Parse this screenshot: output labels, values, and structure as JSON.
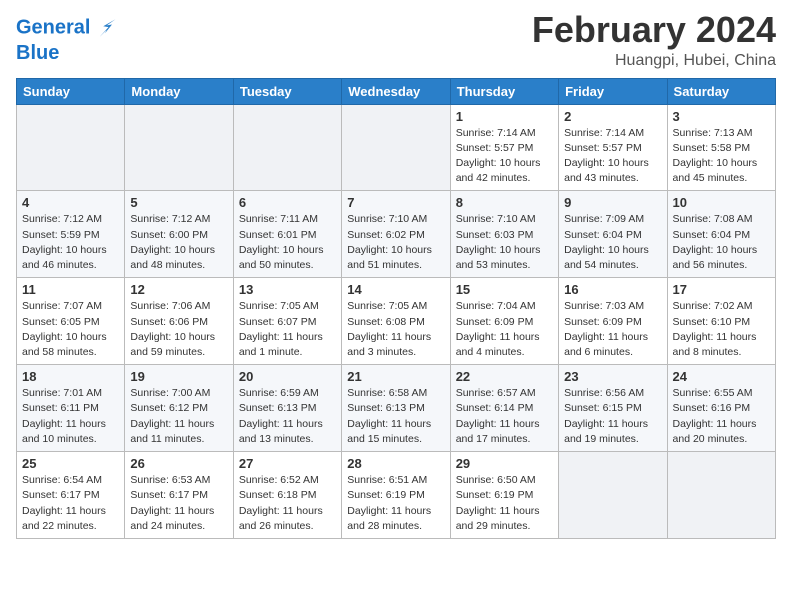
{
  "header": {
    "logo_line1": "General",
    "logo_line2": "Blue",
    "month": "February 2024",
    "location": "Huangpi, Hubei, China"
  },
  "columns": [
    "Sunday",
    "Monday",
    "Tuesday",
    "Wednesday",
    "Thursday",
    "Friday",
    "Saturday"
  ],
  "weeks": [
    [
      {
        "day": "",
        "info": ""
      },
      {
        "day": "",
        "info": ""
      },
      {
        "day": "",
        "info": ""
      },
      {
        "day": "",
        "info": ""
      },
      {
        "day": "1",
        "info": "Sunrise: 7:14 AM\nSunset: 5:57 PM\nDaylight: 10 hours\nand 42 minutes."
      },
      {
        "day": "2",
        "info": "Sunrise: 7:14 AM\nSunset: 5:57 PM\nDaylight: 10 hours\nand 43 minutes."
      },
      {
        "day": "3",
        "info": "Sunrise: 7:13 AM\nSunset: 5:58 PM\nDaylight: 10 hours\nand 45 minutes."
      }
    ],
    [
      {
        "day": "4",
        "info": "Sunrise: 7:12 AM\nSunset: 5:59 PM\nDaylight: 10 hours\nand 46 minutes."
      },
      {
        "day": "5",
        "info": "Sunrise: 7:12 AM\nSunset: 6:00 PM\nDaylight: 10 hours\nand 48 minutes."
      },
      {
        "day": "6",
        "info": "Sunrise: 7:11 AM\nSunset: 6:01 PM\nDaylight: 10 hours\nand 50 minutes."
      },
      {
        "day": "7",
        "info": "Sunrise: 7:10 AM\nSunset: 6:02 PM\nDaylight: 10 hours\nand 51 minutes."
      },
      {
        "day": "8",
        "info": "Sunrise: 7:10 AM\nSunset: 6:03 PM\nDaylight: 10 hours\nand 53 minutes."
      },
      {
        "day": "9",
        "info": "Sunrise: 7:09 AM\nSunset: 6:04 PM\nDaylight: 10 hours\nand 54 minutes."
      },
      {
        "day": "10",
        "info": "Sunrise: 7:08 AM\nSunset: 6:04 PM\nDaylight: 10 hours\nand 56 minutes."
      }
    ],
    [
      {
        "day": "11",
        "info": "Sunrise: 7:07 AM\nSunset: 6:05 PM\nDaylight: 10 hours\nand 58 minutes."
      },
      {
        "day": "12",
        "info": "Sunrise: 7:06 AM\nSunset: 6:06 PM\nDaylight: 10 hours\nand 59 minutes."
      },
      {
        "day": "13",
        "info": "Sunrise: 7:05 AM\nSunset: 6:07 PM\nDaylight: 11 hours\nand 1 minute."
      },
      {
        "day": "14",
        "info": "Sunrise: 7:05 AM\nSunset: 6:08 PM\nDaylight: 11 hours\nand 3 minutes."
      },
      {
        "day": "15",
        "info": "Sunrise: 7:04 AM\nSunset: 6:09 PM\nDaylight: 11 hours\nand 4 minutes."
      },
      {
        "day": "16",
        "info": "Sunrise: 7:03 AM\nSunset: 6:09 PM\nDaylight: 11 hours\nand 6 minutes."
      },
      {
        "day": "17",
        "info": "Sunrise: 7:02 AM\nSunset: 6:10 PM\nDaylight: 11 hours\nand 8 minutes."
      }
    ],
    [
      {
        "day": "18",
        "info": "Sunrise: 7:01 AM\nSunset: 6:11 PM\nDaylight: 11 hours\nand 10 minutes."
      },
      {
        "day": "19",
        "info": "Sunrise: 7:00 AM\nSunset: 6:12 PM\nDaylight: 11 hours\nand 11 minutes."
      },
      {
        "day": "20",
        "info": "Sunrise: 6:59 AM\nSunset: 6:13 PM\nDaylight: 11 hours\nand 13 minutes."
      },
      {
        "day": "21",
        "info": "Sunrise: 6:58 AM\nSunset: 6:13 PM\nDaylight: 11 hours\nand 15 minutes."
      },
      {
        "day": "22",
        "info": "Sunrise: 6:57 AM\nSunset: 6:14 PM\nDaylight: 11 hours\nand 17 minutes."
      },
      {
        "day": "23",
        "info": "Sunrise: 6:56 AM\nSunset: 6:15 PM\nDaylight: 11 hours\nand 19 minutes."
      },
      {
        "day": "24",
        "info": "Sunrise: 6:55 AM\nSunset: 6:16 PM\nDaylight: 11 hours\nand 20 minutes."
      }
    ],
    [
      {
        "day": "25",
        "info": "Sunrise: 6:54 AM\nSunset: 6:17 PM\nDaylight: 11 hours\nand 22 minutes."
      },
      {
        "day": "26",
        "info": "Sunrise: 6:53 AM\nSunset: 6:17 PM\nDaylight: 11 hours\nand 24 minutes."
      },
      {
        "day": "27",
        "info": "Sunrise: 6:52 AM\nSunset: 6:18 PM\nDaylight: 11 hours\nand 26 minutes."
      },
      {
        "day": "28",
        "info": "Sunrise: 6:51 AM\nSunset: 6:19 PM\nDaylight: 11 hours\nand 28 minutes."
      },
      {
        "day": "29",
        "info": "Sunrise: 6:50 AM\nSunset: 6:19 PM\nDaylight: 11 hours\nand 29 minutes."
      },
      {
        "day": "",
        "info": ""
      },
      {
        "day": "",
        "info": ""
      }
    ]
  ]
}
